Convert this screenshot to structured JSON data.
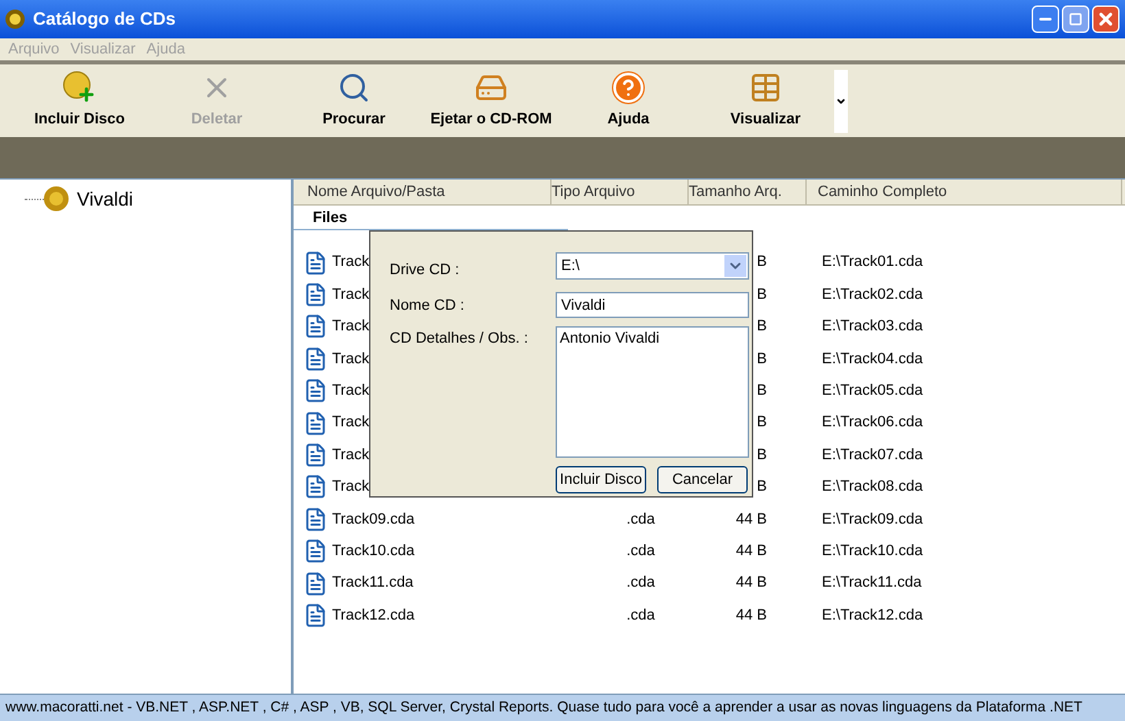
{
  "window": {
    "title": "Catálogo de CDs"
  },
  "menu": [
    "Arquivo",
    "Visualizar",
    "Ajuda"
  ],
  "toolbar": [
    {
      "label": "Incluir Disco",
      "kind": "add-disc",
      "disabled": false
    },
    {
      "label": "Deletar",
      "kind": "delete",
      "disabled": true
    },
    {
      "label": "Procurar",
      "kind": "search",
      "disabled": false
    },
    {
      "label": "Ejetar o CD-ROM",
      "kind": "eject",
      "disabled": false
    },
    {
      "label": "Ajuda",
      "kind": "help",
      "disabled": false
    },
    {
      "label": "Visualizar",
      "kind": "view",
      "disabled": false
    }
  ],
  "tree": [
    {
      "label": "Vivaldi"
    }
  ],
  "list": {
    "columns": [
      "Nome Arquivo/Pasta",
      "Tipo Arquivo",
      "Tamanho Arq.",
      "Caminho Completo"
    ],
    "group": "Files",
    "rows": [
      {
        "name": "Track",
        "size": "B",
        "path": "E:\\Track01.cda"
      },
      {
        "name": "Track",
        "size": "B",
        "path": "E:\\Track02.cda"
      },
      {
        "name": "Track",
        "size": "B",
        "path": "E:\\Track03.cda"
      },
      {
        "name": "Track",
        "size": "B",
        "path": "E:\\Track04.cda"
      },
      {
        "name": "Track",
        "size": "B",
        "path": "E:\\Track05.cda"
      },
      {
        "name": "Track",
        "size": "B",
        "path": "E:\\Track06.cda"
      },
      {
        "name": "Track",
        "size": "B",
        "path": "E:\\Track07.cda"
      },
      {
        "name": "Track",
        "size": "B",
        "path": "E:\\Track08.cda"
      },
      {
        "name": "Track09.cda",
        "type": ".cda",
        "size": "44 B",
        "path": "E:\\Track09.cda"
      },
      {
        "name": "Track10.cda",
        "type": ".cda",
        "size": "44 B",
        "path": "E:\\Track10.cda"
      },
      {
        "name": "Track11.cda",
        "type": ".cda",
        "size": "44 B",
        "path": "E:\\Track11.cda"
      },
      {
        "name": "Track12.cda",
        "type": ".cda",
        "size": "44 B",
        "path": "E:\\Track12.cda"
      }
    ]
  },
  "dialog": {
    "drive_label": "Drive CD :",
    "drive_value": "E:\\",
    "name_label": "Nome CD :",
    "name_value": "Vivaldi",
    "details_label": "CD Detalhes / Obs. :",
    "details_value": "Antonio Vivaldi",
    "buttons": [
      "Incluir Disco",
      "Cancelar"
    ]
  },
  "status_bar": "www.macoratti.net - VB.NET , ASP.NET , C# , ASP , VB,  SQL Server, Crystal Reports. Quase tudo para você a aprender a usar as novas linguagens da Plataforma .NET"
}
